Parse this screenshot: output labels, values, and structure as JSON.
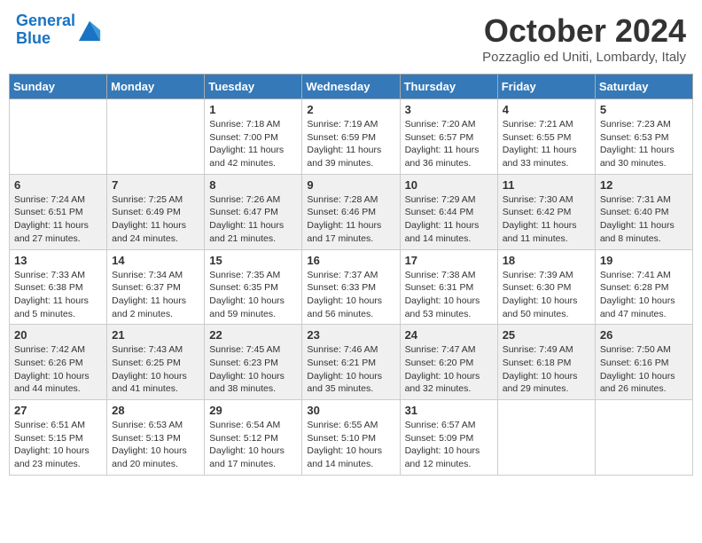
{
  "header": {
    "logo_line1": "General",
    "logo_line2": "Blue",
    "month_title": "October 2024",
    "location": "Pozzaglio ed Uniti, Lombardy, Italy"
  },
  "weekdays": [
    "Sunday",
    "Monday",
    "Tuesday",
    "Wednesday",
    "Thursday",
    "Friday",
    "Saturday"
  ],
  "weeks": [
    [
      {
        "day": "",
        "sunrise": "",
        "sunset": "",
        "daylight": ""
      },
      {
        "day": "",
        "sunrise": "",
        "sunset": "",
        "daylight": ""
      },
      {
        "day": "1",
        "sunrise": "Sunrise: 7:18 AM",
        "sunset": "Sunset: 7:00 PM",
        "daylight": "Daylight: 11 hours and 42 minutes."
      },
      {
        "day": "2",
        "sunrise": "Sunrise: 7:19 AM",
        "sunset": "Sunset: 6:59 PM",
        "daylight": "Daylight: 11 hours and 39 minutes."
      },
      {
        "day": "3",
        "sunrise": "Sunrise: 7:20 AM",
        "sunset": "Sunset: 6:57 PM",
        "daylight": "Daylight: 11 hours and 36 minutes."
      },
      {
        "day": "4",
        "sunrise": "Sunrise: 7:21 AM",
        "sunset": "Sunset: 6:55 PM",
        "daylight": "Daylight: 11 hours and 33 minutes."
      },
      {
        "day": "5",
        "sunrise": "Sunrise: 7:23 AM",
        "sunset": "Sunset: 6:53 PM",
        "daylight": "Daylight: 11 hours and 30 minutes."
      }
    ],
    [
      {
        "day": "6",
        "sunrise": "Sunrise: 7:24 AM",
        "sunset": "Sunset: 6:51 PM",
        "daylight": "Daylight: 11 hours and 27 minutes."
      },
      {
        "day": "7",
        "sunrise": "Sunrise: 7:25 AM",
        "sunset": "Sunset: 6:49 PM",
        "daylight": "Daylight: 11 hours and 24 minutes."
      },
      {
        "day": "8",
        "sunrise": "Sunrise: 7:26 AM",
        "sunset": "Sunset: 6:47 PM",
        "daylight": "Daylight: 11 hours and 21 minutes."
      },
      {
        "day": "9",
        "sunrise": "Sunrise: 7:28 AM",
        "sunset": "Sunset: 6:46 PM",
        "daylight": "Daylight: 11 hours and 17 minutes."
      },
      {
        "day": "10",
        "sunrise": "Sunrise: 7:29 AM",
        "sunset": "Sunset: 6:44 PM",
        "daylight": "Daylight: 11 hours and 14 minutes."
      },
      {
        "day": "11",
        "sunrise": "Sunrise: 7:30 AM",
        "sunset": "Sunset: 6:42 PM",
        "daylight": "Daylight: 11 hours and 11 minutes."
      },
      {
        "day": "12",
        "sunrise": "Sunrise: 7:31 AM",
        "sunset": "Sunset: 6:40 PM",
        "daylight": "Daylight: 11 hours and 8 minutes."
      }
    ],
    [
      {
        "day": "13",
        "sunrise": "Sunrise: 7:33 AM",
        "sunset": "Sunset: 6:38 PM",
        "daylight": "Daylight: 11 hours and 5 minutes."
      },
      {
        "day": "14",
        "sunrise": "Sunrise: 7:34 AM",
        "sunset": "Sunset: 6:37 PM",
        "daylight": "Daylight: 11 hours and 2 minutes."
      },
      {
        "day": "15",
        "sunrise": "Sunrise: 7:35 AM",
        "sunset": "Sunset: 6:35 PM",
        "daylight": "Daylight: 10 hours and 59 minutes."
      },
      {
        "day": "16",
        "sunrise": "Sunrise: 7:37 AM",
        "sunset": "Sunset: 6:33 PM",
        "daylight": "Daylight: 10 hours and 56 minutes."
      },
      {
        "day": "17",
        "sunrise": "Sunrise: 7:38 AM",
        "sunset": "Sunset: 6:31 PM",
        "daylight": "Daylight: 10 hours and 53 minutes."
      },
      {
        "day": "18",
        "sunrise": "Sunrise: 7:39 AM",
        "sunset": "Sunset: 6:30 PM",
        "daylight": "Daylight: 10 hours and 50 minutes."
      },
      {
        "day": "19",
        "sunrise": "Sunrise: 7:41 AM",
        "sunset": "Sunset: 6:28 PM",
        "daylight": "Daylight: 10 hours and 47 minutes."
      }
    ],
    [
      {
        "day": "20",
        "sunrise": "Sunrise: 7:42 AM",
        "sunset": "Sunset: 6:26 PM",
        "daylight": "Daylight: 10 hours and 44 minutes."
      },
      {
        "day": "21",
        "sunrise": "Sunrise: 7:43 AM",
        "sunset": "Sunset: 6:25 PM",
        "daylight": "Daylight: 10 hours and 41 minutes."
      },
      {
        "day": "22",
        "sunrise": "Sunrise: 7:45 AM",
        "sunset": "Sunset: 6:23 PM",
        "daylight": "Daylight: 10 hours and 38 minutes."
      },
      {
        "day": "23",
        "sunrise": "Sunrise: 7:46 AM",
        "sunset": "Sunset: 6:21 PM",
        "daylight": "Daylight: 10 hours and 35 minutes."
      },
      {
        "day": "24",
        "sunrise": "Sunrise: 7:47 AM",
        "sunset": "Sunset: 6:20 PM",
        "daylight": "Daylight: 10 hours and 32 minutes."
      },
      {
        "day": "25",
        "sunrise": "Sunrise: 7:49 AM",
        "sunset": "Sunset: 6:18 PM",
        "daylight": "Daylight: 10 hours and 29 minutes."
      },
      {
        "day": "26",
        "sunrise": "Sunrise: 7:50 AM",
        "sunset": "Sunset: 6:16 PM",
        "daylight": "Daylight: 10 hours and 26 minutes."
      }
    ],
    [
      {
        "day": "27",
        "sunrise": "Sunrise: 6:51 AM",
        "sunset": "Sunset: 5:15 PM",
        "daylight": "Daylight: 10 hours and 23 minutes."
      },
      {
        "day": "28",
        "sunrise": "Sunrise: 6:53 AM",
        "sunset": "Sunset: 5:13 PM",
        "daylight": "Daylight: 10 hours and 20 minutes."
      },
      {
        "day": "29",
        "sunrise": "Sunrise: 6:54 AM",
        "sunset": "Sunset: 5:12 PM",
        "daylight": "Daylight: 10 hours and 17 minutes."
      },
      {
        "day": "30",
        "sunrise": "Sunrise: 6:55 AM",
        "sunset": "Sunset: 5:10 PM",
        "daylight": "Daylight: 10 hours and 14 minutes."
      },
      {
        "day": "31",
        "sunrise": "Sunrise: 6:57 AM",
        "sunset": "Sunset: 5:09 PM",
        "daylight": "Daylight: 10 hours and 12 minutes."
      },
      {
        "day": "",
        "sunrise": "",
        "sunset": "",
        "daylight": ""
      },
      {
        "day": "",
        "sunrise": "",
        "sunset": "",
        "daylight": ""
      }
    ]
  ]
}
